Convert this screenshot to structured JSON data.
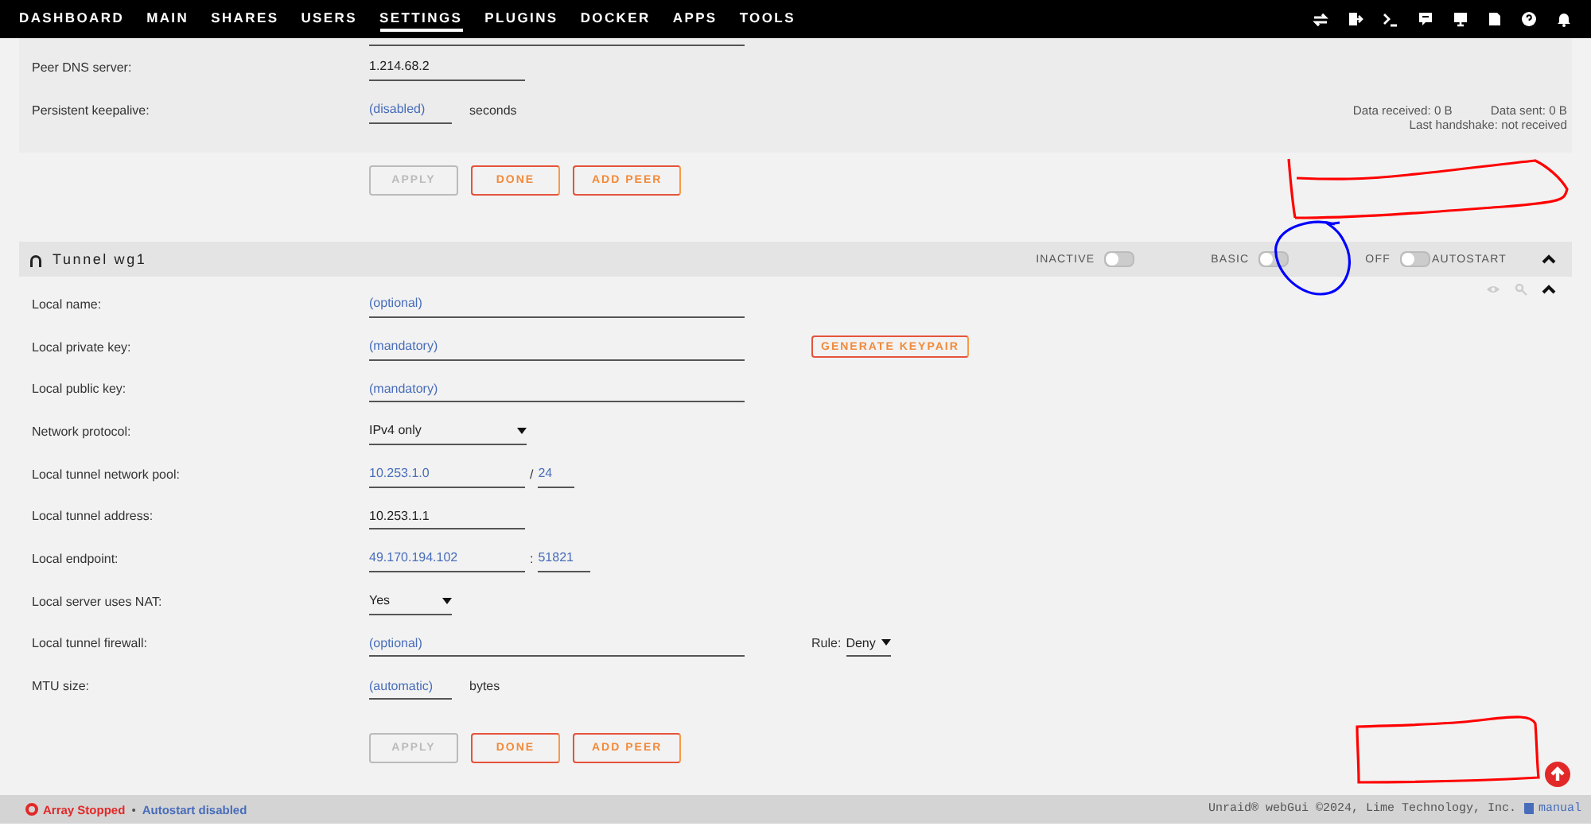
{
  "nav": [
    {
      "label": "DASHBOARD",
      "selected": false
    },
    {
      "label": "MAIN",
      "selected": false
    },
    {
      "label": "SHARES",
      "selected": false
    },
    {
      "label": "USERS",
      "selected": false
    },
    {
      "label": "SETTINGS",
      "selected": true
    },
    {
      "label": "PLUGINS",
      "selected": false
    },
    {
      "label": "DOCKER",
      "selected": false
    },
    {
      "label": "APPS",
      "selected": false
    },
    {
      "label": "TOOLS",
      "selected": false
    }
  ],
  "peer": {
    "rows": [
      {
        "label": "Peer DNS server:",
        "items": [
          {
            "kind": "narrow",
            "value": "1.214.68.2"
          }
        ]
      },
      {
        "label": "Persistent keepalive:",
        "items": [
          {
            "kind": "small",
            "placeholder": "(disabled)"
          },
          {
            "kind": "text",
            "text": "seconds"
          }
        ]
      }
    ],
    "stats": {
      "received": "Data received: 0 B",
      "sent": "Data sent: 0 B",
      "handshake": "Last handshake: not received"
    },
    "buttons": [
      {
        "label": "APPLY",
        "disabled": true
      },
      {
        "label": "DONE",
        "disabled": false
      },
      {
        "label": "ADD PEER",
        "disabled": false
      }
    ]
  },
  "tunnel": {
    "title": "Tunnel wg1",
    "toggles": [
      {
        "label": "INACTIVE",
        "on": false
      },
      {
        "label": "BASIC",
        "on": false
      },
      {
        "label": "OFF",
        "on": false,
        "after": "AUTOSTART"
      }
    ],
    "rows": [
      {
        "label": "Local name:",
        "items": [
          {
            "kind": "wide",
            "placeholder": "(optional)"
          }
        ]
      },
      {
        "label": "Local private key:",
        "items": [
          {
            "kind": "wide",
            "placeholder": "(mandatory)"
          },
          {
            "kind": "button",
            "text": "GENERATE KEYPAIR"
          }
        ]
      },
      {
        "label": "Local public key:",
        "items": [
          {
            "kind": "wide",
            "placeholder": "(mandatory)"
          }
        ]
      },
      {
        "label": "Network protocol:",
        "items": [
          {
            "kind": "select",
            "value": "IPv4 only"
          }
        ]
      },
      {
        "label": "Local tunnel network pool:",
        "items": [
          {
            "kind": "narrow",
            "placeholder": "10.253.1.0"
          },
          {
            "kind": "sep",
            "text": "/"
          },
          {
            "kind": "tiny",
            "placeholder": "24"
          }
        ]
      },
      {
        "label": "Local tunnel address:",
        "items": [
          {
            "kind": "narrow",
            "value": "10.253.1.1"
          }
        ]
      },
      {
        "label": "Local endpoint:",
        "items": [
          {
            "kind": "narrow",
            "placeholder": "49.170.194.102"
          },
          {
            "kind": "sep",
            "text": ":"
          },
          {
            "kind": "port",
            "placeholder": "51821"
          }
        ]
      },
      {
        "label": "Local server uses NAT:",
        "items": [
          {
            "kind": "select-small",
            "value": "Yes"
          }
        ]
      },
      {
        "label": "Local tunnel firewall:",
        "items": [
          {
            "kind": "wide",
            "placeholder": "(optional)"
          },
          {
            "kind": "rule",
            "text": "Rule:",
            "value": "Deny"
          }
        ]
      },
      {
        "label": "MTU size:",
        "items": [
          {
            "kind": "small",
            "placeholder": "(automatic)"
          },
          {
            "kind": "text",
            "text": "bytes"
          }
        ]
      }
    ],
    "buttons": [
      {
        "label": "APPLY",
        "disabled": true
      },
      {
        "label": "DONE",
        "disabled": false
      },
      {
        "label": "ADD PEER",
        "disabled": false
      }
    ]
  },
  "footer": {
    "array": "Array Stopped",
    "dot": "•",
    "autostart": "Autostart disabled",
    "copyright": "Unraid® webGui ©2024, Lime Technology, Inc.",
    "manual": "manual"
  }
}
